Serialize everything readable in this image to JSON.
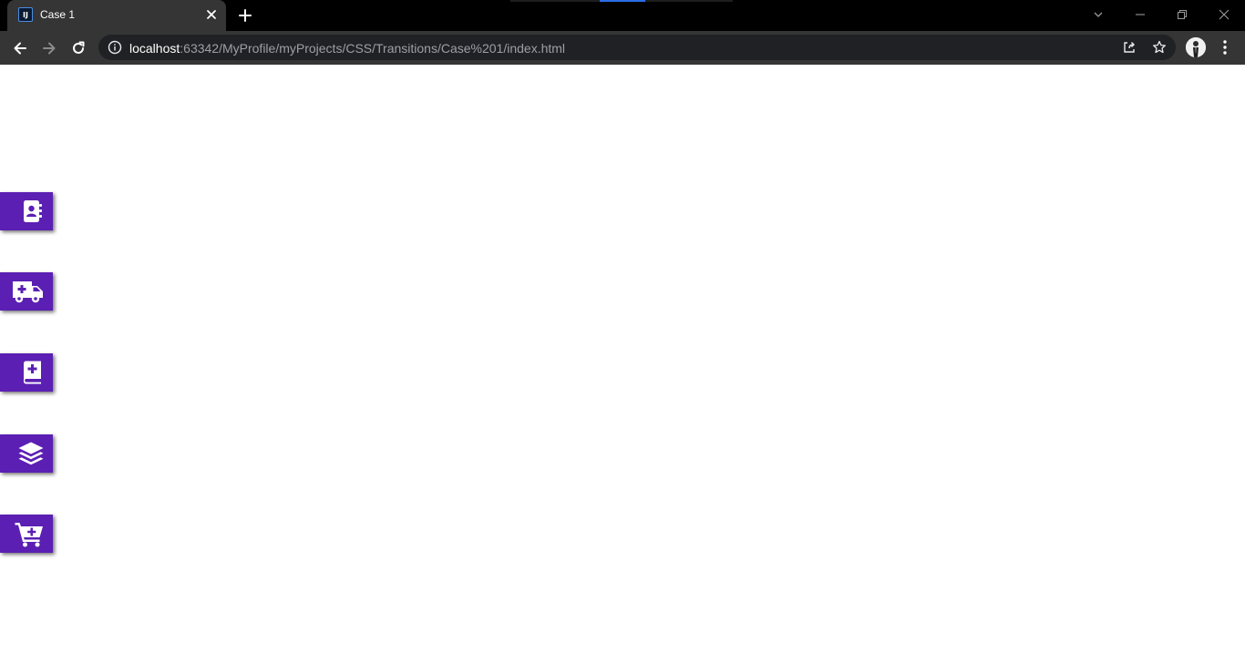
{
  "browser": {
    "tab": {
      "title": "Case 1",
      "favicon_text": "IJ"
    },
    "address": {
      "host": "localhost",
      "rest": ":63342/MyProfile/myProjects/CSS/Transitions/Case%201/index.html"
    },
    "colors": {
      "frame": "#000000",
      "toolbar": "#353535",
      "omnibox": "#202124"
    }
  },
  "page": {
    "background": "#ffffff",
    "accent": "#5b1fb3",
    "side_buttons": [
      {
        "icon": "address-book-icon"
      },
      {
        "icon": "ambulance-icon"
      },
      {
        "icon": "medical-book-icon"
      },
      {
        "icon": "layers-icon"
      },
      {
        "icon": "cart-plus-icon"
      }
    ]
  }
}
